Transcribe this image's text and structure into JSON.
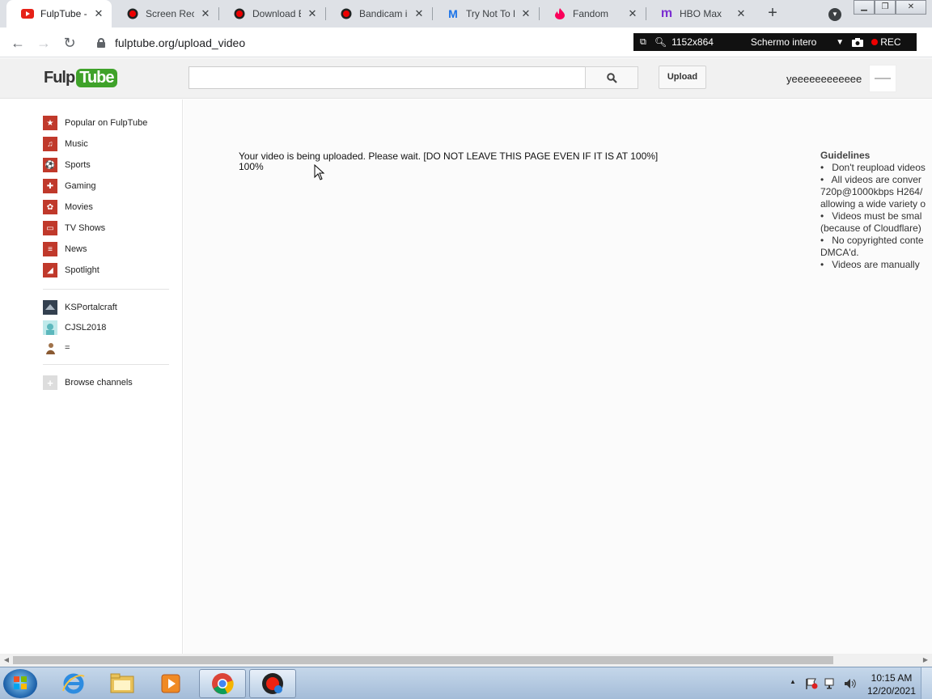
{
  "browser": {
    "tabs": [
      {
        "title": "FulpTube - U",
        "favicon": "youtube-red-icon",
        "active": true
      },
      {
        "title": "Screen Reco",
        "favicon": "bandicam-icon"
      },
      {
        "title": "Download Ba",
        "favicon": "bandicam-icon"
      },
      {
        "title": "Bandicam in",
        "favicon": "bandicam-icon"
      },
      {
        "title": "Try Not To La",
        "favicon": "m-blue-icon"
      },
      {
        "title": "Fandom",
        "favicon": "fandom-flame-icon"
      },
      {
        "title": "HBO Max",
        "favicon": "hbo-max-icon"
      }
    ],
    "close_glyph": "✕",
    "newtab_glyph": "+",
    "url": "fulptube.org/upload_video"
  },
  "recorder": {
    "resolution": "1152x864",
    "mode": "Schermo intero",
    "rec_label": "REC"
  },
  "site": {
    "logo_part1": "Fulp",
    "logo_part2": "Tube",
    "search_placeholder": "",
    "upload_label": "Upload",
    "username": "yeeeeeeeeeeee"
  },
  "sidebar": {
    "categories": [
      {
        "label": "Popular on FulpTube",
        "icon": "star-icon",
        "glyph": "★"
      },
      {
        "label": "Music",
        "icon": "headphones-icon",
        "glyph": "♫"
      },
      {
        "label": "Sports",
        "icon": "sports-ball-icon",
        "glyph": "⚽"
      },
      {
        "label": "Gaming",
        "icon": "gamepad-icon",
        "glyph": "✚"
      },
      {
        "label": "Movies",
        "icon": "film-reel-icon",
        "glyph": "✿"
      },
      {
        "label": "TV Shows",
        "icon": "tv-icon",
        "glyph": "▭"
      },
      {
        "label": "News",
        "icon": "newspaper-icon",
        "glyph": "≡"
      },
      {
        "label": "Spotlight",
        "icon": "spotlight-icon",
        "glyph": "◢"
      }
    ],
    "channels": [
      {
        "label": "KSPortalcraft",
        "icon": "channel-avatar-icon"
      },
      {
        "label": "CJSL2018",
        "icon": "channel-avatar-icon"
      },
      {
        "label": "=",
        "icon": "channel-avatar-icon"
      }
    ],
    "browse_label": "Browse channels"
  },
  "main": {
    "upload_message": "Your video is being uploaded. Please wait. [DO NOT LEAVE THIS PAGE EVEN IF IT IS AT 100%]",
    "progress_text": "100%",
    "guidelines_title": "Guidelines",
    "guidelines": [
      "•   Don't reupload videos",
      "•   All videos are conver",
      "720p@1000kbps H264/",
      "allowing a wide variety o",
      "•   Videos must be smal",
      "(because of Cloudflare)",
      "•   No copyrighted conte",
      "DMCA'd.",
      "•   Videos are manually"
    ]
  },
  "taskbar": {
    "time": "10:15 AM",
    "date": "12/20/2021",
    "tray_up_glyph": "▲"
  }
}
